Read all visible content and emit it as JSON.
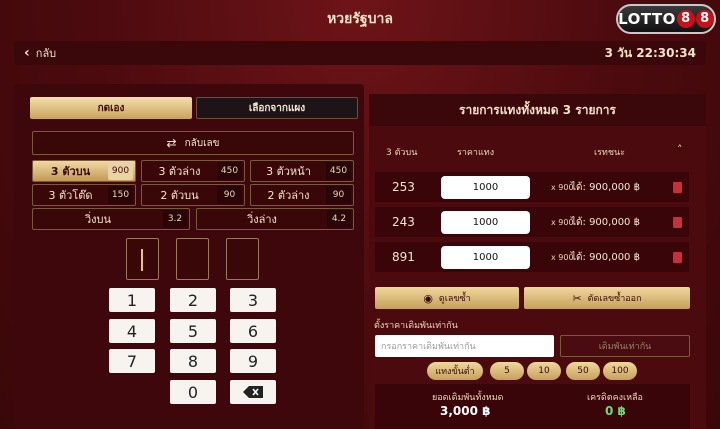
{
  "header": {
    "title": "หวยรัฐบาล",
    "logo": "LOTTO88",
    "back_label": "กลับ",
    "countdown": "3 วัน 22:30:34"
  },
  "left": {
    "tabs": [
      "กดเอง",
      "เลือกจากแผง"
    ],
    "shuffle_label": "กลับเลข",
    "bet_types": [
      {
        "name": "3 ตัวบน",
        "rate": "900"
      },
      {
        "name": "3 ตัวล่าง",
        "rate": "450"
      },
      {
        "name": "3 ตัวหน้า",
        "rate": "450"
      },
      {
        "name": "3 ตัวโต๊ด",
        "rate": "150"
      },
      {
        "name": "2 ตัวบน",
        "rate": "90"
      },
      {
        "name": "2 ตัวล่าง",
        "rate": "90"
      },
      {
        "name": "วิ่งบน",
        "rate": "3.2"
      },
      {
        "name": "วิ่งล่าง",
        "rate": "4.2"
      }
    ],
    "keypad": [
      "1",
      "2",
      "3",
      "4",
      "5",
      "6",
      "7",
      "8",
      "9",
      "0"
    ]
  },
  "right": {
    "title": "รายการแทงทั้งหมด 3 รายการ",
    "columns": [
      "3 ตัวบน",
      "ราคาแทง",
      "เรทชนะ"
    ],
    "entries": [
      {
        "number": "253",
        "amount": "1000",
        "mult": "x 900",
        "win": "ได้: 900,000 ฿"
      },
      {
        "number": "243",
        "amount": "1000",
        "mult": "x 900",
        "win": "ได้: 900,000 ฿"
      },
      {
        "number": "891",
        "amount": "1000",
        "mult": "x 900",
        "win": "ได้: 900,000 ฿"
      }
    ],
    "view_duplicates": "ดูเลขซ้ำ",
    "remove_duplicates": "ตัดเลขซ้ำออก",
    "set_all_label": "ตั้งราคาเดิมพันเท่ากัน",
    "set_all_placeholder": "กรอกราคาเดิมพันเท่ากัน",
    "set_all_button": "เดิมพันเท่ากัน",
    "chips": [
      "แทงขั้นต่ำ",
      "5",
      "10",
      "50",
      "100"
    ],
    "total_label": "ยอดเดิมพันทั้งหมด",
    "total_value": "3,000 ฿",
    "credit_label": "เครดิตคงเหลือ",
    "credit_value": "0 ฿"
  }
}
